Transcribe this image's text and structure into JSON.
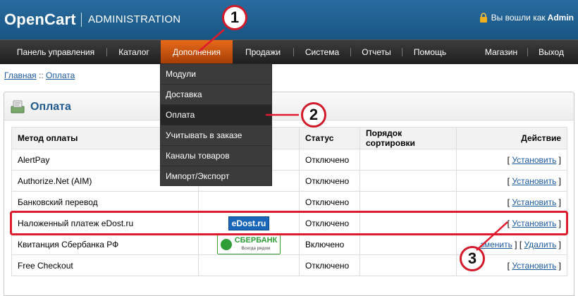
{
  "header": {
    "brand": "OpenCart",
    "section": "ADMINISTRATION",
    "login_text": "Вы вошли как",
    "login_user": "Admin"
  },
  "menu": [
    {
      "label": "Панель управления"
    },
    {
      "label": "Каталог"
    },
    {
      "label": "Дополнения",
      "active": true
    },
    {
      "label": "Продажи"
    },
    {
      "label": "Система"
    },
    {
      "label": "Отчеты"
    },
    {
      "label": "Помощь"
    },
    {
      "label": "Магазин"
    },
    {
      "label": "Выход"
    }
  ],
  "dropdown": [
    {
      "label": "Модули"
    },
    {
      "label": "Доставка"
    },
    {
      "label": "Оплата",
      "hover": true
    },
    {
      "label": "Учитывать в заказе"
    },
    {
      "label": "Каналы товаров"
    },
    {
      "label": "Импорт/Экспорт"
    }
  ],
  "breadcrumb": {
    "home": "Главная",
    "sep": " :: ",
    "current": "Оплата"
  },
  "box": {
    "title": "Оплата"
  },
  "table": {
    "headers": [
      "Метод оплаты",
      "",
      "Статус",
      "Порядок сортировки",
      "Действие"
    ],
    "rows": [
      {
        "name": "AlertPay",
        "status": "Отключено",
        "actions": [
          "Установить"
        ]
      },
      {
        "name": "Authorize.Net (AIM)",
        "status": "Отключено",
        "actions": [
          "Установить"
        ]
      },
      {
        "name": "Банковский перевод",
        "status": "Отключено",
        "actions": [
          "Установить"
        ]
      },
      {
        "name": "Наложенный платеж eDost.ru",
        "logo": "eDost.ru",
        "status": "Отключено",
        "actions": [
          "Установить"
        ]
      },
      {
        "name": "Квитанция Сбербанка РФ",
        "logo": "СБЕРБАНК",
        "logo_sub": "Всегда рядом",
        "status": "Включено",
        "actions": [
          "Изменить",
          "Удалить"
        ],
        "action_first_visible": "зменить"
      },
      {
        "name": "Free Checkout",
        "status": "Отключено",
        "actions": [
          "Установить"
        ]
      }
    ]
  },
  "callouts": [
    "1",
    "2",
    "3"
  ],
  "colors": {
    "header_blue": "#175582",
    "menu_dark": "#1e1e1e",
    "menu_active": "#e86a1a",
    "annotation_red": "#e0192c"
  }
}
